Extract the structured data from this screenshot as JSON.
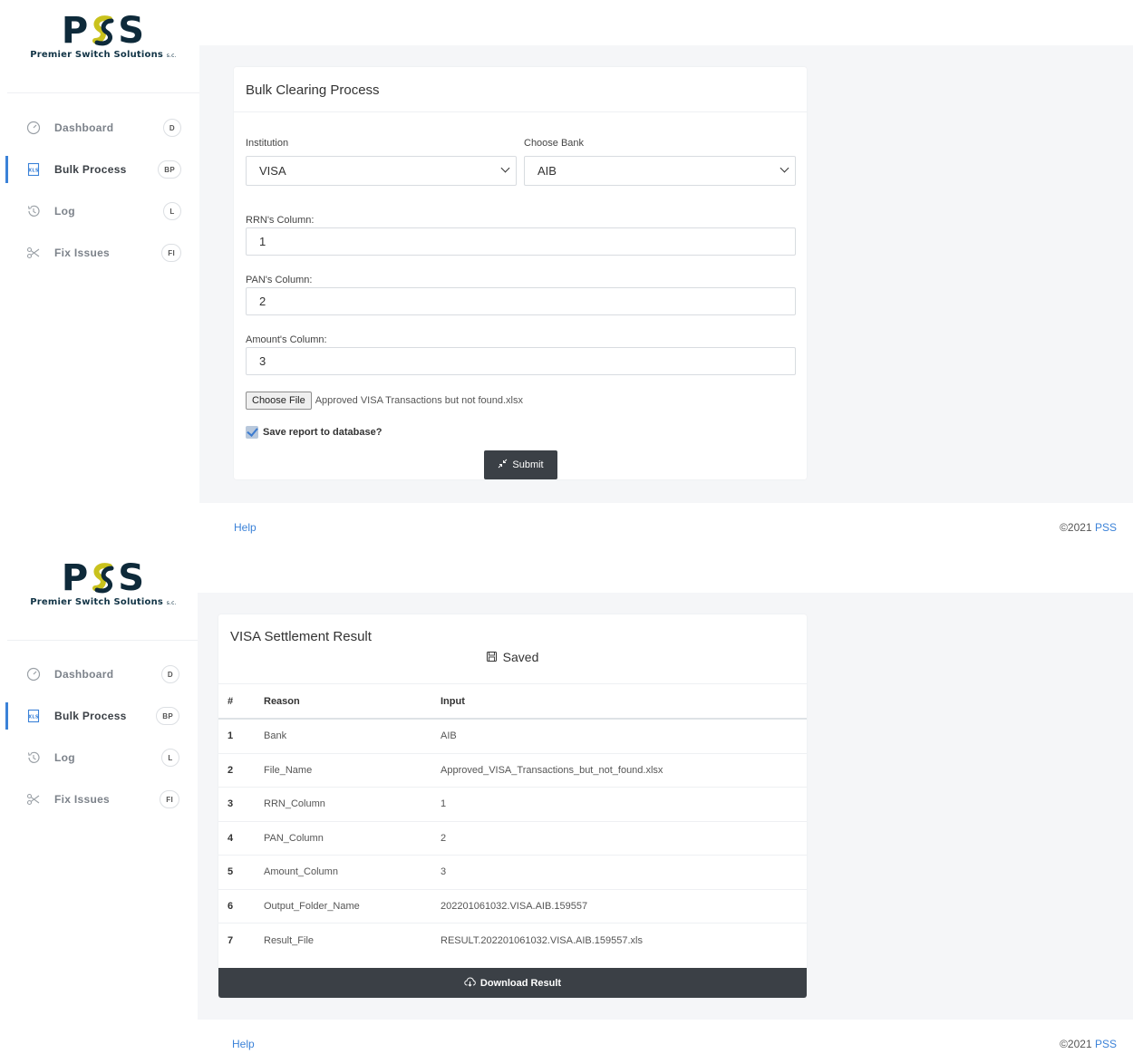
{
  "brand": {
    "logo_letters_left": "P",
    "logo_letters_right": "S",
    "logo_name": "Premier Switch Solutions",
    "logo_suffix": "s.c.",
    "accent_color": "#3b82d8",
    "logo_swirl_colors": [
      "#0e2a3a",
      "#c9c21d"
    ]
  },
  "sidebar": {
    "items": [
      {
        "label": "Dashboard",
        "badge": "D",
        "icon": "speedometer-icon"
      },
      {
        "label": "Bulk Process",
        "badge": "BP",
        "icon": "xls-file-icon",
        "active": true
      },
      {
        "label": "Log",
        "badge": "L",
        "icon": "history-icon"
      },
      {
        "label": "Fix Issues",
        "badge": "FI",
        "icon": "scissors-icon"
      }
    ]
  },
  "form": {
    "title": "Bulk Clearing Process",
    "institution_label": "Institution",
    "institution_value": "VISA",
    "bank_label": "Choose Bank",
    "bank_value": "AIB",
    "rrn_label": "RRN's Column:",
    "rrn_value": "1",
    "pan_label": "PAN's Column:",
    "pan_value": "2",
    "amount_label": "Amount's Column:",
    "amount_value": "3",
    "file_button": "Choose File",
    "file_name": "Approved VISA Transactions but not found.xlsx",
    "save_label": "Save report to database?",
    "save_checked": true,
    "submit_label": "Submit"
  },
  "result": {
    "title": "VISA Settlement Result",
    "status": "Saved",
    "columns": [
      "#",
      "Reason",
      "Input"
    ],
    "rows": [
      {
        "num": "1",
        "reason": "Bank",
        "input": "AIB"
      },
      {
        "num": "2",
        "reason": "File_Name",
        "input": "Approved_VISA_Transactions_but_not_found.xlsx"
      },
      {
        "num": "3",
        "reason": "RRN_Column",
        "input": "1"
      },
      {
        "num": "4",
        "reason": "PAN_Column",
        "input": "2"
      },
      {
        "num": "5",
        "reason": "Amount_Column",
        "input": "3"
      },
      {
        "num": "6",
        "reason": "Output_Folder_Name",
        "input": "202201061032.VISA.AIB.159557"
      },
      {
        "num": "7",
        "reason": "Result_File",
        "input": "RESULT.202201061032.VISA.AIB.159557.xls"
      }
    ],
    "download_label": "Download Result"
  },
  "footer": {
    "help": "Help",
    "copyright": "©2021",
    "brand_link": "PSS"
  }
}
